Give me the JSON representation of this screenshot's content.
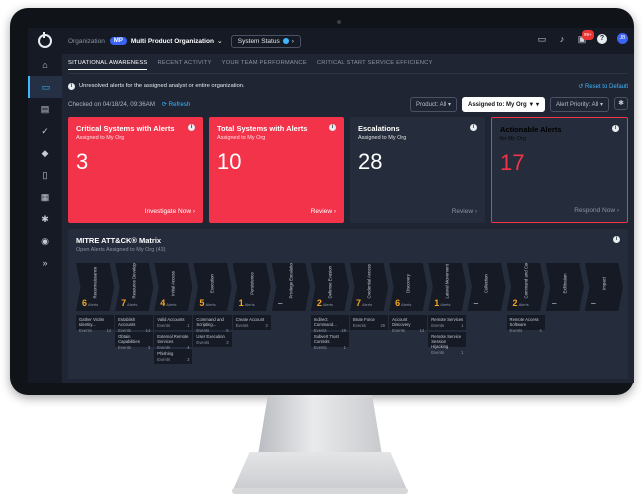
{
  "topbar": {
    "org_label": "Organization",
    "org_badge": "MP",
    "org_name": "Multi Product Organization",
    "system_status": "System Status",
    "notif_badge": "99+",
    "help": "?",
    "avatar": "JB"
  },
  "sidebar": {
    "items": [
      "home-icon",
      "monitor-icon",
      "inbox-icon",
      "check-circle-icon",
      "shield-icon",
      "document-icon",
      "building-icon",
      "gear-icon",
      "eye-icon",
      "expand-icon"
    ]
  },
  "tabs": [
    "SITUATIONAL AWARENESS",
    "RECENT ACTIVITY",
    "YOUR TEAM PERFORMANCE",
    "CRITICAL START SERVICE EFFICIENCY"
  ],
  "banner": {
    "text": "Unresolved alerts for the assigned analyst or entire organization.",
    "reset": "Reset to Default"
  },
  "checked": {
    "text": "Checked on 04/18/24, 09:36AM",
    "refresh": "Refresh"
  },
  "filters": {
    "product": "Product: All",
    "assigned": "Assigned to: My Org",
    "priority": "Alert Priority: All"
  },
  "cards": [
    {
      "title": "Critical Systems with Alerts",
      "sub": "Assigned to My Org",
      "value": "3",
      "link": "Investigate Now"
    },
    {
      "title": "Total Systems with Alerts",
      "sub": "Assigned to My Org",
      "value": "10",
      "link": "Review"
    },
    {
      "title": "Escalations",
      "sub": "Assigned to My Org",
      "value": "28",
      "link": "Review"
    },
    {
      "title": "Actionable Alerts",
      "sub": "for My Org",
      "value": "17",
      "link": "Respond Now"
    }
  ],
  "mitre": {
    "title": "MITRE ATT&CK® Matrix",
    "sub": "Open Alerts Assigned to My Org (43)",
    "alerts_word": "Alerts",
    "tactics": [
      {
        "name": "Reconnaissance",
        "count": "6"
      },
      {
        "name": "Resource Development",
        "count": "7"
      },
      {
        "name": "Initial Access",
        "count": "4"
      },
      {
        "name": "Execution",
        "count": "5"
      },
      {
        "name": "Persistence",
        "count": "1"
      },
      {
        "name": "Privilege Escalation",
        "count": "–"
      },
      {
        "name": "Defense Evasion",
        "count": "2"
      },
      {
        "name": "Credential Access",
        "count": "7"
      },
      {
        "name": "Discovery",
        "count": "6"
      },
      {
        "name": "Lateral Movement",
        "count": "1"
      },
      {
        "name": "Collection",
        "count": "–"
      },
      {
        "name": "Command and Control",
        "count": "2"
      },
      {
        "name": "Exfiltration",
        "count": "–"
      },
      {
        "name": "Impact",
        "count": "–"
      }
    ],
    "techniques": [
      [
        {
          "name": "Gather Victim Identity...",
          "events": "14"
        }
      ],
      [
        {
          "name": "Establish Accounts",
          "events": "14"
        },
        {
          "name": "Obtain Capabilities",
          "events": "3"
        }
      ],
      [
        {
          "name": "Valid Accounts",
          "events": "1"
        },
        {
          "name": "External Remote Services",
          "events": "4"
        },
        {
          "name": "Phishing",
          "events": "3"
        }
      ],
      [
        {
          "name": "Command and Scripting...",
          "events": "5"
        },
        {
          "name": "User Execution",
          "events": "3"
        }
      ],
      [
        {
          "name": "Create Account",
          "events": "3"
        }
      ],
      [],
      [
        {
          "name": "Indirect Command...",
          "events": "19"
        },
        {
          "name": "Subvert Trust Controls",
          "events": "1"
        }
      ],
      [
        {
          "name": "Brute Force",
          "events": "26"
        }
      ],
      [
        {
          "name": "Account Discovery",
          "events": "14"
        }
      ],
      [
        {
          "name": "Remote Services",
          "events": "1"
        },
        {
          "name": "Remote Service Session Hijacking",
          "events": "1"
        }
      ],
      [],
      [
        {
          "name": "Remote Access Software",
          "events": "4"
        }
      ],
      [],
      []
    ],
    "events_word": "Events"
  }
}
